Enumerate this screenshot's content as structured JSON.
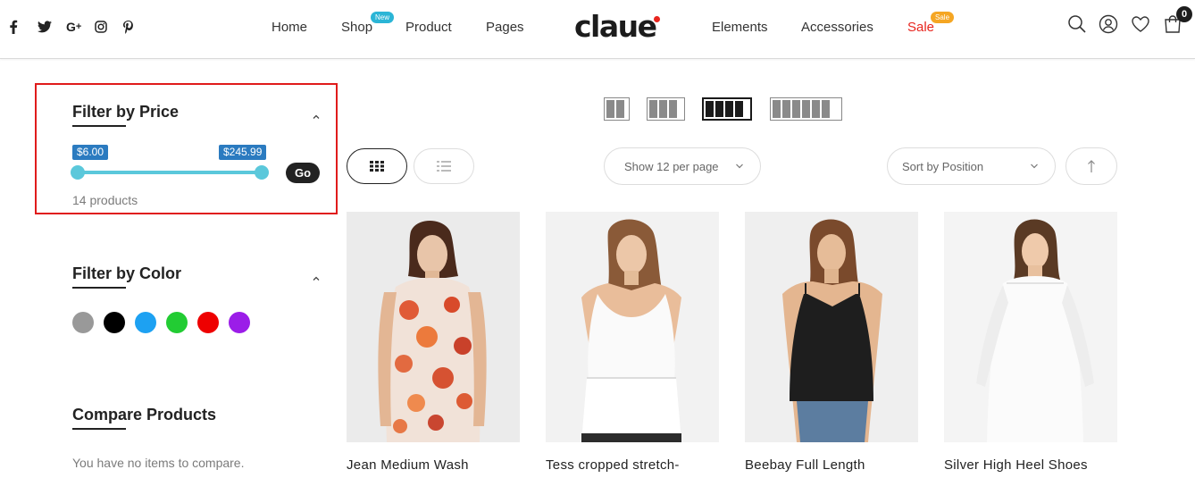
{
  "header": {
    "social": [
      {
        "name": "facebook-icon",
        "glyph": "f"
      },
      {
        "name": "twitter-icon",
        "glyph": "t"
      },
      {
        "name": "google-plus-icon",
        "glyph": "G+"
      },
      {
        "name": "instagram-icon",
        "glyph": "ig"
      },
      {
        "name": "pinterest-icon",
        "glyph": "p"
      }
    ],
    "nav_left": [
      {
        "label": "Home"
      },
      {
        "label": "Shop",
        "badge": "New"
      },
      {
        "label": "Product"
      },
      {
        "label": "Pages"
      }
    ],
    "logo": "claue",
    "nav_right": [
      {
        "label": "Elements"
      },
      {
        "label": "Accessories"
      },
      {
        "label": "Sale",
        "badge": "Sale"
      }
    ],
    "cart_count": "0",
    "colors": {
      "new_badge": "#2bb5d6",
      "sale_badge": "#f5a623",
      "sale_text": "#e8251e",
      "logo_dot": "#e8251e"
    }
  },
  "sidebar": {
    "price_filter": {
      "title": "Filter by Price",
      "min_label": "$6.00",
      "max_label": "$245.99",
      "go_label": "Go",
      "count_text": "14 products"
    },
    "color_filter": {
      "title": "Filter by Color",
      "swatches": [
        "#999999",
        "#000000",
        "#1da1f2",
        "#22cc33",
        "#ee0000",
        "#9b1de8"
      ]
    },
    "compare": {
      "title": "Compare Products",
      "empty_text": "You have no items to compare."
    }
  },
  "toolbar": {
    "columns_options": [
      "2",
      "3",
      "4",
      "6"
    ],
    "active_columns": "4",
    "view_modes": [
      "grid",
      "list"
    ],
    "active_view": "grid",
    "per_page_label": "Show 12 per page",
    "sort_label": "Sort by Position"
  },
  "products": [
    {
      "name": "Jean Medium Wash"
    },
    {
      "name": "Tess cropped stretch-"
    },
    {
      "name": "Beebay Full Length"
    },
    {
      "name": "Silver High Heel Shoes"
    }
  ]
}
